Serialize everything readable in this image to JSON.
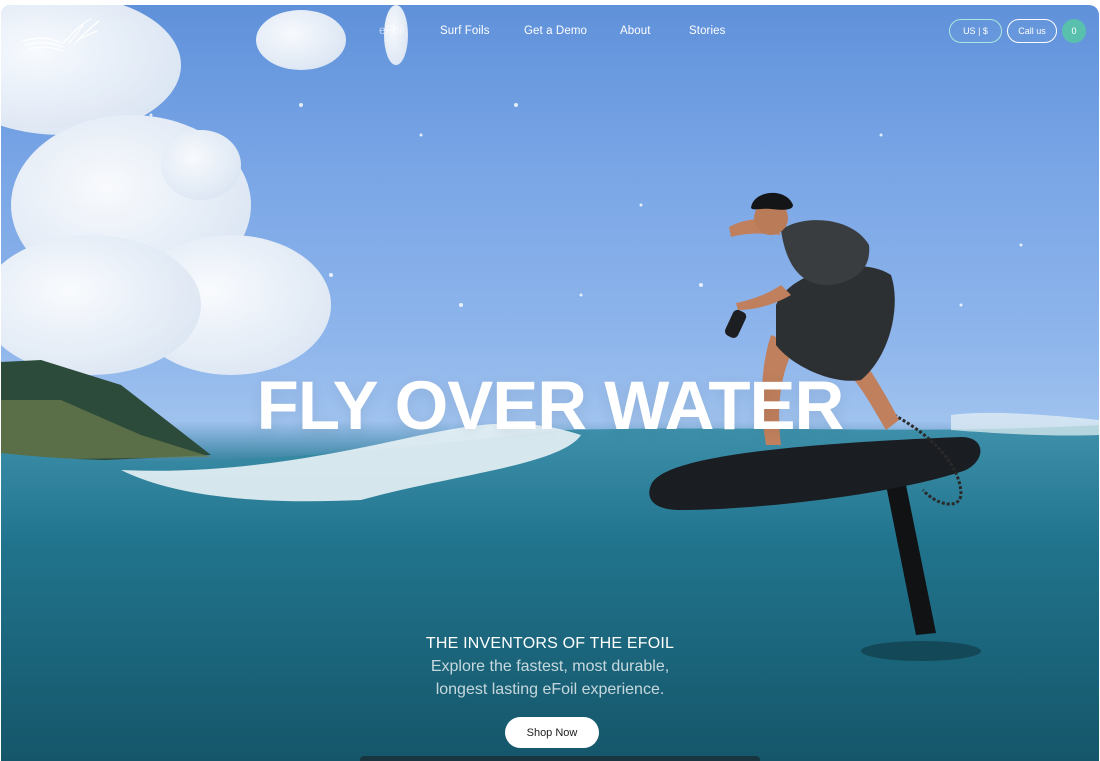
{
  "nav": {
    "links": [
      "eFoil",
      "Surf Foils",
      "Get a Demo",
      "About",
      "Stories"
    ],
    "currency_label": "US | $",
    "call_label": "Call us",
    "cart_count": "0"
  },
  "logo": {
    "text": "Lift",
    "icon": "wing-logo-icon"
  },
  "hero": {
    "title": "FLY OVER WATER",
    "tagline": "THE INVENTORS OF THE EFOIL",
    "subline_1": "Explore the fastest, most durable,",
    "subline_2": "longest lasting eFoil experience.",
    "cta_label": "Shop Now"
  },
  "colors": {
    "accent": "#58c0ac",
    "sky": "#6f9fe0",
    "ocean": "#1f6d86",
    "text": "#ffffff"
  }
}
